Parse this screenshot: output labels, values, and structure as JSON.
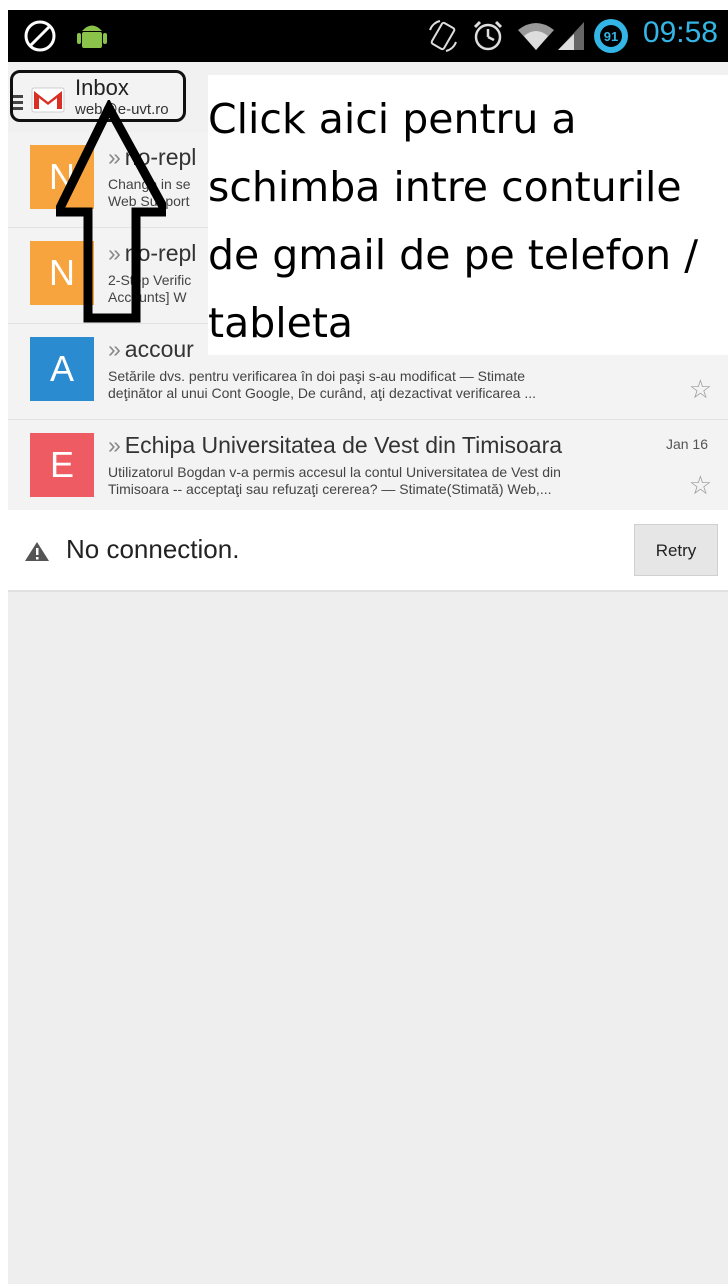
{
  "statusbar": {
    "time": "09:58",
    "battery_level": "91",
    "icons": [
      "no-signal-icon",
      "android-debug-icon",
      "rotate-icon",
      "alarm-icon",
      "wifi-icon",
      "cell-signal-icon",
      "battery-icon"
    ]
  },
  "actionbar": {
    "title": "Inbox",
    "account": "web@e-uvt.ro"
  },
  "messages": [
    {
      "letter": "N",
      "color": "#f7a33e",
      "sender": "no-repl",
      "subject": "Change in se",
      "preview": "Web Support",
      "date": "",
      "starred": false
    },
    {
      "letter": "N",
      "color": "#f7a33e",
      "sender": "no-repl",
      "subject": "2-Step Verific",
      "preview": "Accounts] W",
      "date": "",
      "starred": false
    },
    {
      "letter": "A",
      "color": "#2a8bd0",
      "sender": "accour",
      "subject": "Setările dvs. pentru verificarea în doi paşi s-au modificat — Stimate",
      "preview": "deţinător al unui Cont Google, De curând, aţi dezactivat verificarea ...",
      "date": "",
      "starred": false
    },
    {
      "letter": "E",
      "color": "#ef5b63",
      "sender": "Echipa Universitatea de Vest din Timisoara",
      "subject": "Utilizatorul Bogdan v-a permis accesul la contul Universitatea de Vest din",
      "preview": "Timisoara -- acceptaţi sau refuzaţi cererea? — Stimate(Stimată) Web,...",
      "date": "Jan 16",
      "starred": false
    }
  ],
  "annotation": {
    "text": "Click aici pentru a schimba intre conturile de gmail de pe telefon / tableta"
  },
  "connection": {
    "message": "No connection.",
    "retry_label": "Retry"
  },
  "colors": {
    "accent": "#33b5e5",
    "background": "#f1f1f1"
  }
}
